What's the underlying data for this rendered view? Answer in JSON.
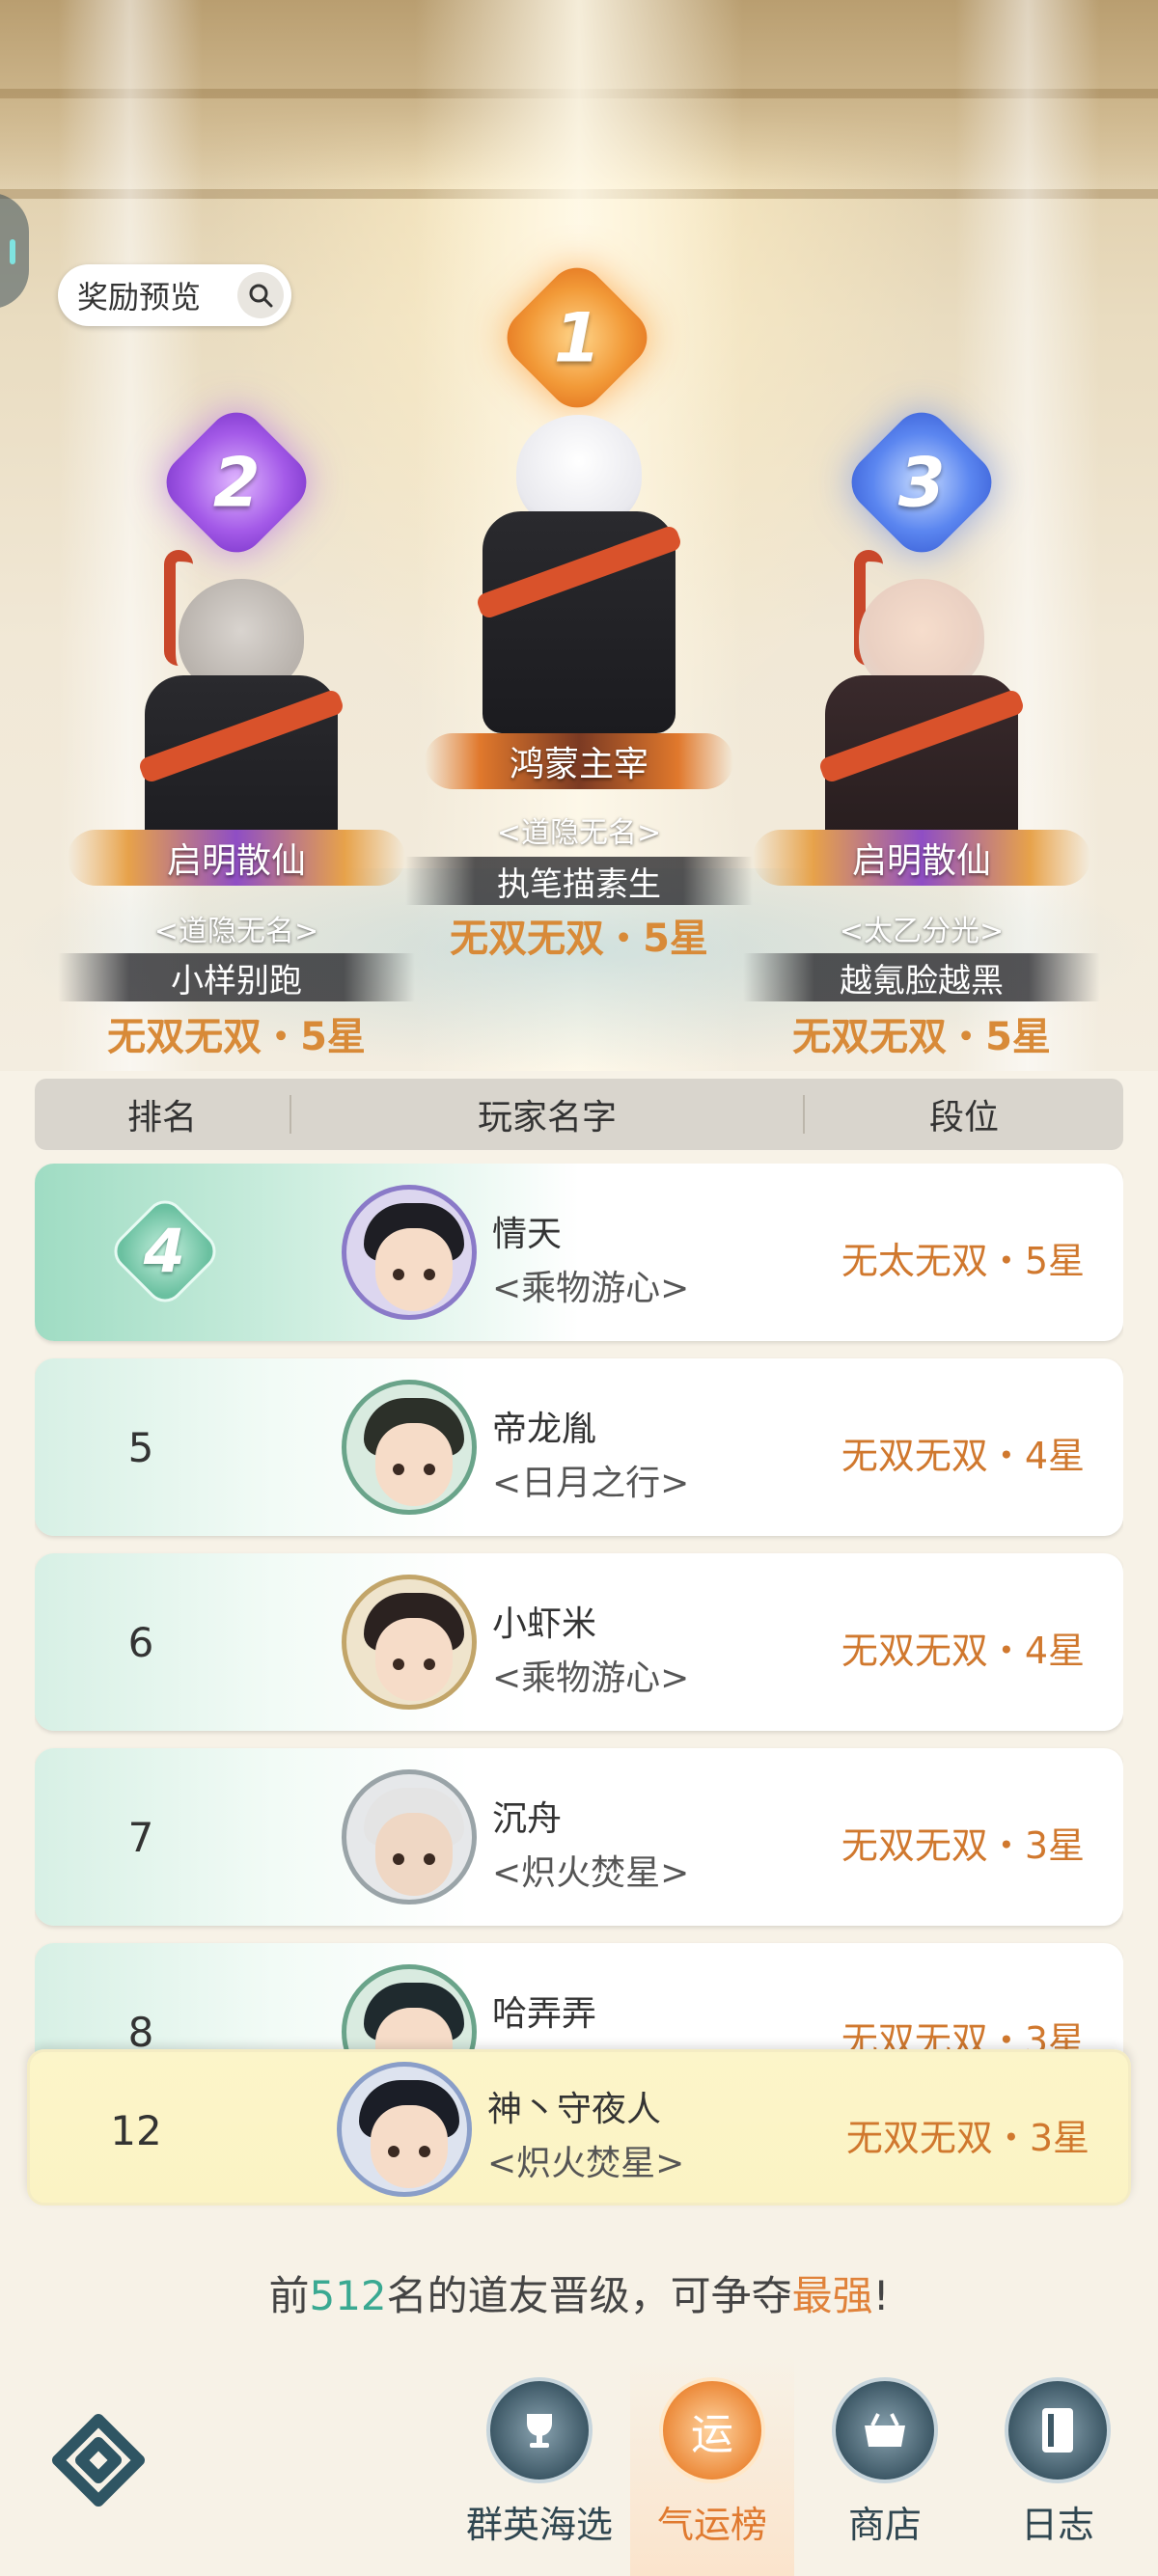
{
  "reward_preview": {
    "label": "奖励预览",
    "icon": "search-icon"
  },
  "podium": [
    {
      "rank": "2",
      "title": "启明散仙",
      "guild": "<道隐无名>",
      "player": "小样别跑",
      "tier": "无双无双・5星"
    },
    {
      "rank": "1",
      "title": "鸿蒙主宰",
      "guild": "<道隐无名>",
      "player": "执笔描素生",
      "tier": "无双无双・5星"
    },
    {
      "rank": "3",
      "title": "启明散仙",
      "guild": "<太乙分光>",
      "player": "越氪脸越黑",
      "tier": "无双无双・5星"
    }
  ],
  "table": {
    "headers": {
      "rank": "排名",
      "name": "玩家名字",
      "tier": "段位"
    },
    "rows": [
      {
        "rank": "4",
        "name": "情天",
        "guild": "<乘物游心>",
        "tier": "无太无双・5星"
      },
      {
        "rank": "5",
        "name": "帝龙胤",
        "guild": "<日月之行>",
        "tier": "无双无双・4星"
      },
      {
        "rank": "6",
        "name": "小虾米",
        "guild": "<乘物游心>",
        "tier": "无双无双・4星"
      },
      {
        "rank": "7",
        "name": "沉舟",
        "guild": "<炽火焚星>",
        "tier": "无双无双・3星"
      },
      {
        "rank": "8",
        "name": "哈弄弄",
        "guild": "",
        "tier": "无双无双・3星"
      }
    ]
  },
  "my_rank": {
    "rank": "12",
    "name": "神丶守夜人",
    "guild": "<炽火焚星>",
    "tier": "无双无双・3星"
  },
  "promo": {
    "prefix": "前",
    "count": "512",
    "middle": "名的道友晋级，可争夺",
    "highlight": "最强",
    "suffix": "!"
  },
  "nav": {
    "home_icon": "home-diamond-icon",
    "items": [
      {
        "label": "群英海选",
        "icon": "trophy-icon"
      },
      {
        "label": "气运榜",
        "icon": "运"
      },
      {
        "label": "商店",
        "icon": "shop-icon"
      },
      {
        "label": "日志",
        "icon": "book-icon"
      }
    ]
  },
  "colors": {
    "tier_text": "#d0782e",
    "accent_green": "#3aa992",
    "accent_orange": "#e0823a"
  }
}
